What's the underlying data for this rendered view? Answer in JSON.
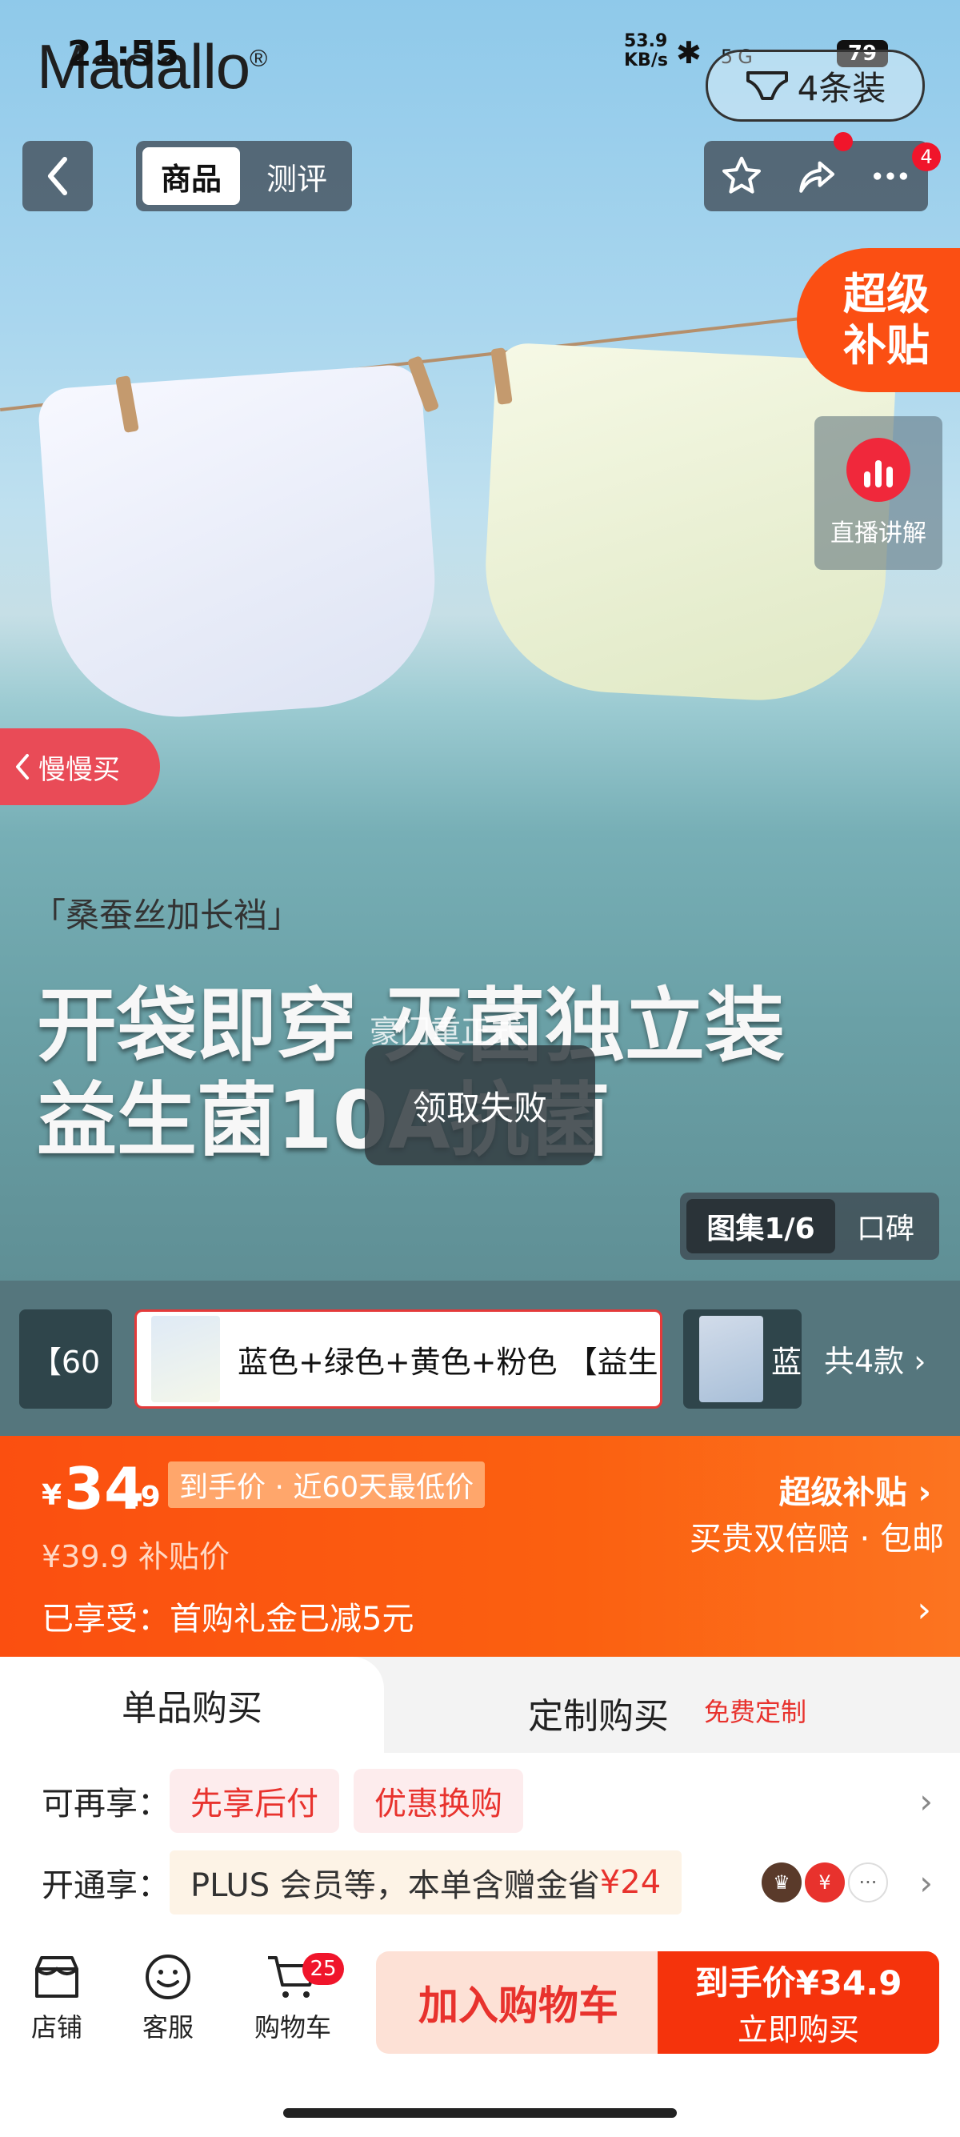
{
  "status": {
    "time": "21:55",
    "net_speed": "53.9",
    "net_unit": "KB/s",
    "network": "5G",
    "battery": "79"
  },
  "brand": {
    "name": "Madallo",
    "mark": "®"
  },
  "pack_pill": {
    "label": "4条装"
  },
  "header": {
    "tabs": [
      {
        "label": "商品"
      },
      {
        "label": "测评"
      }
    ],
    "cart_badge": "4"
  },
  "subsidy_corner": {
    "line1": "超级",
    "line2": "补贴"
  },
  "live": {
    "label": "直播讲解"
  },
  "slow_buy": {
    "label": "慢慢买"
  },
  "hero": {
    "tagline": "「桑蚕丝加长裆」",
    "headline1": "开袋即穿 灭菌独立装",
    "headline2": "益生菌10A抗菌",
    "hint": "豪门重正式",
    "toast": "领取失败"
  },
  "gallery": {
    "active": "图集1/6",
    "other": "口碑"
  },
  "variants": {
    "prev_label": "【60",
    "selected_label": "蓝色+绿色+黄色+粉色 【益生",
    "next_label": "蓝",
    "count": "共4款"
  },
  "price": {
    "currency": "¥",
    "integer": "34",
    "decimal": ".9",
    "tag": "到手价 · 近60天最低价",
    "old": "¥39.9  补贴价",
    "subsidy_title": "超级补贴",
    "subsidy_sub": "买贵双倍赔 · 包邮",
    "enjoy": "已享受：首购礼金已减5元"
  },
  "purchase_mode": {
    "single": "单品购买",
    "custom": "定制购买",
    "custom_tag": "免费定制"
  },
  "row_perks": {
    "label": "可再享：",
    "chips": [
      "先享后付",
      "优惠换购"
    ]
  },
  "row_plus": {
    "label": "开通享：",
    "text": "PLUS 会员等，本单含赠金省",
    "amount": "¥24"
  },
  "bottom_bar": {
    "store": "店铺",
    "service": "客服",
    "cart": "购物车",
    "cart_badge": "25",
    "add_cart": "加入购物车",
    "buy_top": "到手价¥34.9",
    "buy_bottom": "立即购买"
  },
  "colors": {
    "accent": "#fb4f13",
    "red": "#e8322d",
    "variant_bar": "#55767d"
  }
}
